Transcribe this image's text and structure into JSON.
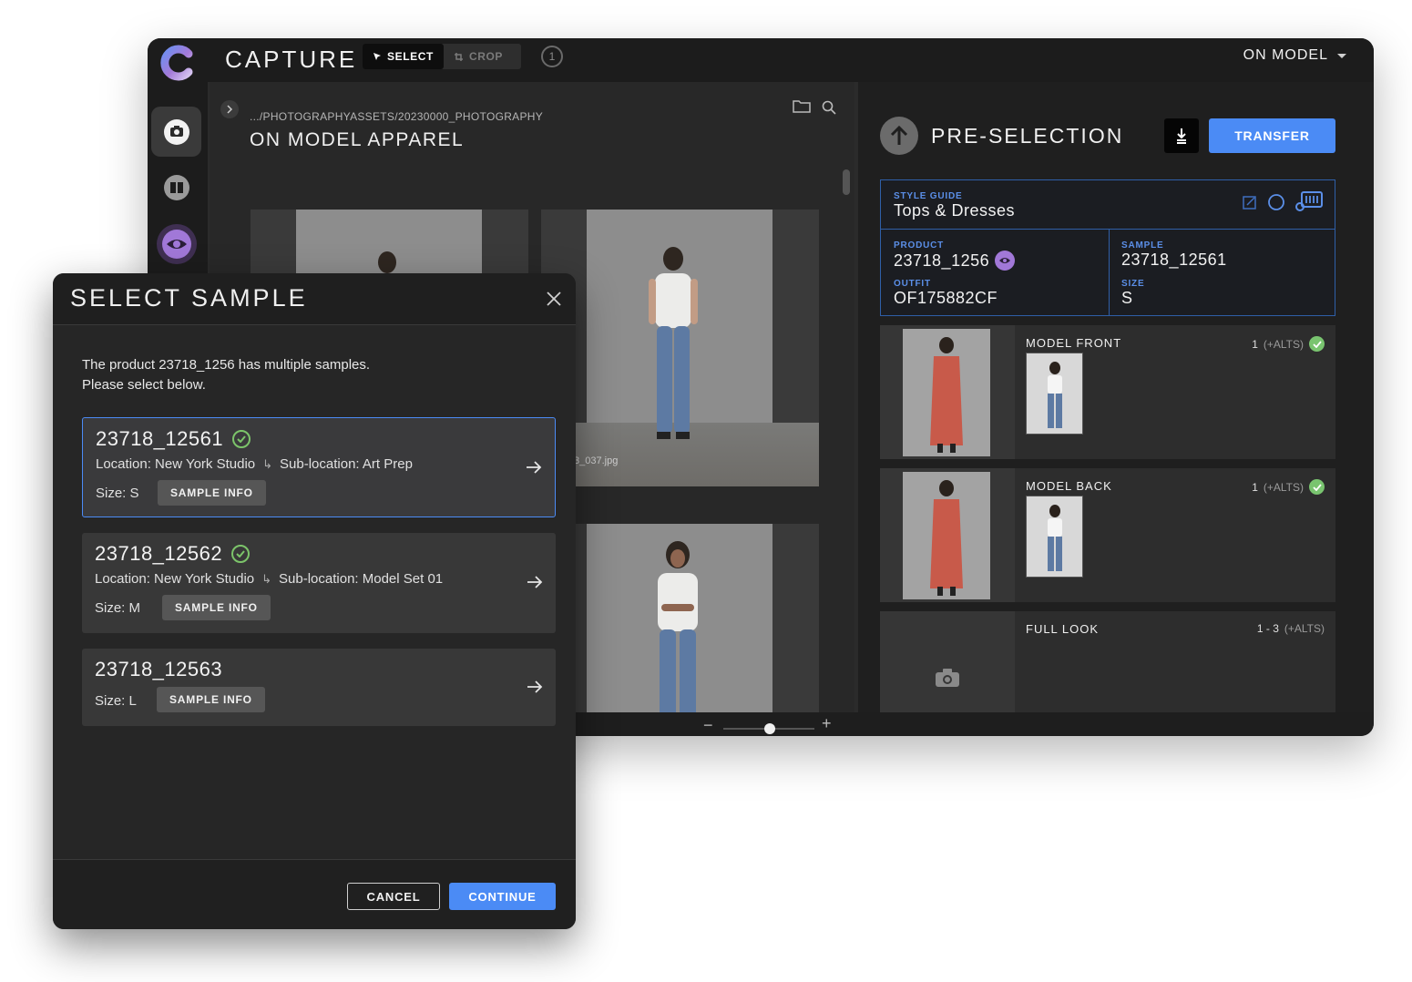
{
  "app": {
    "title": "CAPTURE",
    "tools": {
      "select": "SELECT",
      "crop": "CROP"
    },
    "info": "1",
    "mode": "ON MODEL"
  },
  "browser": {
    "path": ".../PHOTOGRAPHYASSETS/20230000_PHOTOGRAPHY",
    "title": "ON MODEL APPAREL",
    "filename": "3_037.jpg"
  },
  "preselection": {
    "title": "PRE-SELECTION",
    "transfer_label": "TRANSFER",
    "style_guide": {
      "label": "STYLE GUIDE",
      "value": "Tops & Dresses"
    },
    "product": {
      "label": "PRODUCT",
      "value": "23718_1256"
    },
    "sample": {
      "label": "SAMPLE",
      "value": "23718_12561"
    },
    "outfit": {
      "label": "OUTFIT",
      "value": "OF175882CF"
    },
    "size": {
      "label": "SIZE",
      "value": "S"
    },
    "shots": [
      {
        "name": "MODEL FRONT",
        "count": "1",
        "alts": "(+ALTS)",
        "done": true
      },
      {
        "name": "MODEL BACK",
        "count": "1",
        "alts": "(+ALTS)",
        "done": true
      },
      {
        "name": "FULL LOOK",
        "count": "1 - 3",
        "alts": "(+ALTS)",
        "done": false
      }
    ]
  },
  "dialog": {
    "title": "SELECT SAMPLE",
    "message_line1": "The product 23718_1256 has multiple samples.",
    "message_line2": "Please select below.",
    "samples": [
      {
        "id": "23718_12561",
        "location": "Location: New York Studio",
        "sublocation": "Sub-location: Art Prep",
        "size": "Size: S",
        "info_label": "SAMPLE INFO",
        "selected": true
      },
      {
        "id": "23718_12562",
        "location": "Location: New York Studio",
        "sublocation": "Sub-location: Model Set 01",
        "size": "Size: M",
        "info_label": "SAMPLE INFO",
        "selected": false
      },
      {
        "id": "23718_12563",
        "size": "Size: L",
        "info_label": "SAMPLE INFO",
        "selected": false
      }
    ],
    "cancel_label": "CANCEL",
    "continue_label": "CONTINUE"
  },
  "colors": {
    "accent": "#4b8bf5",
    "success": "#79c46f",
    "eye_badge": "#a178d8",
    "panel": "#1f1f1f"
  },
  "icons": [
    "capture-logo",
    "camera-icon",
    "book-icon",
    "eye-icon",
    "folder-icon",
    "search-icon",
    "upload-arrow-icon",
    "download-icon",
    "close-icon",
    "arrow-right-icon",
    "check-icon"
  ]
}
